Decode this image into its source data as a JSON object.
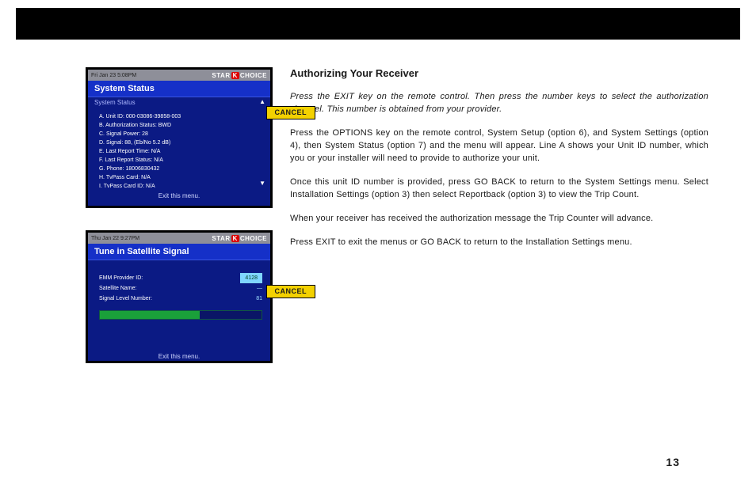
{
  "page_number": "13",
  "section_title": "Authorizing Your Receiver",
  "paragraphs": {
    "p1": "Press the EXIT key on the remote control. Then press the number keys to select the authorization channel. This number is obtained from your provider.",
    "p2": "Press the OPTIONS key on the remote control, System Setup (option 6), and System Settings (option 4), then System Status (option 7) and the menu will appear. Line A shows your Unit ID number, which you or your installer will need to provide to authorize your unit.",
    "p3": "Once this unit ID number is provided, press GO BACK to return to the System Settings menu. Select Installation Settings (option 3) then select Reportback (option 3) to view the Trip Count.",
    "p4": "When your receiver has received the authorization message the Trip Counter will advance.",
    "p5": "Press EXIT to exit the menus or GO BACK to return to the Installation Settings menu."
  },
  "thumb1": {
    "datetime": "Fri Jan 23 5:08PM",
    "brand_left": "STAR",
    "brand_k": "K",
    "brand_right": "CHOICE",
    "title": "System Status",
    "subtitle": "System Status",
    "lines": {
      "a": "A. Unit ID:   000-03086-39858-003",
      "b": "B. Authorization Status:  BWD",
      "c": "C. Signal Power:   28",
      "d": "D. Signal:   88, (Eb/No 5.2 dB)",
      "e": "E. Last Report Time:   N/A",
      "f": "F. Last Report Status:   N/A",
      "g": "G. Phone:   18006830432",
      "h": "H. TvPass Card:   N/A",
      "i": "I. TvPass Card ID:   N/A"
    },
    "exit_hint": "Exit this menu.",
    "cancel": "CANCEL"
  },
  "thumb2": {
    "datetime": "Thu Jan 22 9:27PM",
    "brand_left": "STAR",
    "brand_k": "K",
    "brand_right": "CHOICE",
    "title": "Tune in Satellite Signal",
    "rows": {
      "r1_label": "EMM Provider ID:",
      "r1_value": "4128",
      "r2_label": "Satellite Name:",
      "r2_value": "—",
      "r3_label": "Signal Level Number:",
      "r3_value": "81"
    },
    "meter_pct": "62",
    "exit_hint": "Exit this menu.",
    "cancel": "CANCEL"
  }
}
